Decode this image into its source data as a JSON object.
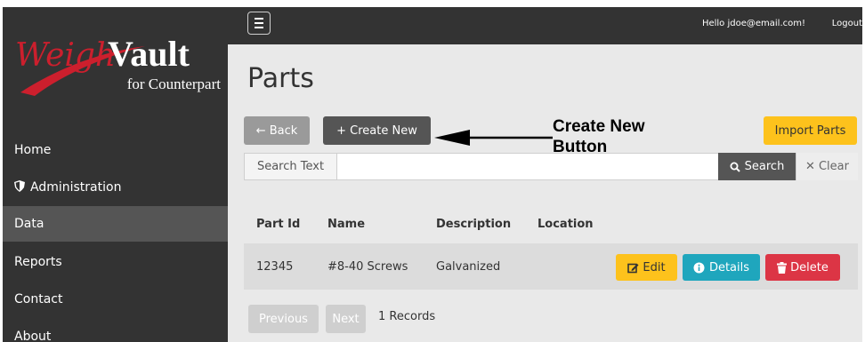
{
  "logo": {
    "brand_a": "Weigh",
    "brand_b": "Vault",
    "tagline": "for Counterpart"
  },
  "sidebar": {
    "items": [
      {
        "label": "Home",
        "icon": ""
      },
      {
        "label": "Administration",
        "icon": "shield-icon"
      },
      {
        "label": "Data",
        "icon": ""
      },
      {
        "label": "Reports",
        "icon": ""
      },
      {
        "label": "Contact",
        "icon": ""
      },
      {
        "label": "About",
        "icon": ""
      }
    ],
    "active": "Data"
  },
  "topbar": {
    "greeting": "Hello jdoe@email.com!",
    "logout": "Logout"
  },
  "page": {
    "title": "Parts"
  },
  "toolbar": {
    "back": "← Back",
    "create": "+ Create New",
    "import": "Import Parts"
  },
  "search": {
    "label": "Search Text",
    "value": "",
    "placeholder": "",
    "search_btn": "Search",
    "clear_btn": "Clear"
  },
  "table": {
    "headers": [
      "Part Id",
      "Name",
      "Description",
      "Location"
    ],
    "rows": [
      {
        "part_id": "12345",
        "name": "#8-40 Screws",
        "description": "Galvanized",
        "location": ""
      }
    ],
    "actions": {
      "edit": "Edit",
      "details": "Details",
      "delete": "Delete"
    }
  },
  "pager": {
    "previous": "Previous",
    "next": "Next",
    "records": "1 Records"
  },
  "annotation": {
    "line1": "Create New",
    "line2": "Button"
  },
  "colors": {
    "dark": "#333333",
    "warning": "#fdc21c",
    "info": "#1fa6bd",
    "danger": "#dc3545",
    "logo_red": "#cc1f2d"
  }
}
